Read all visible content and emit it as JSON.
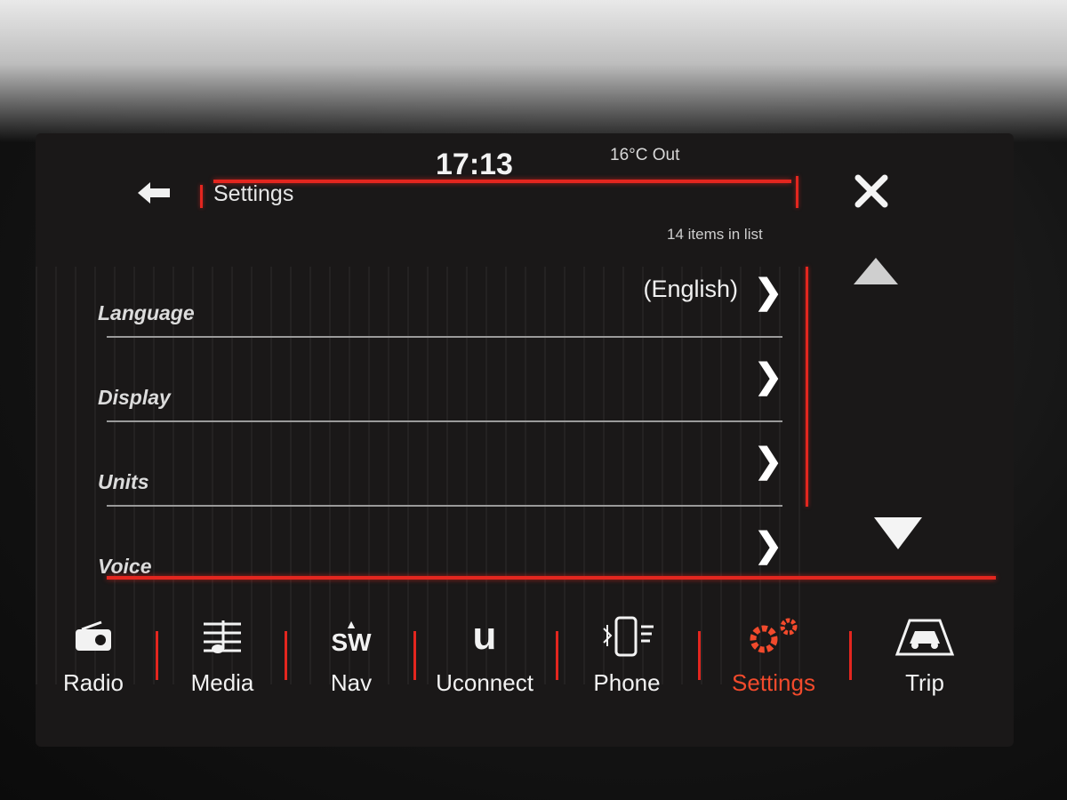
{
  "status": {
    "time": "17:13",
    "outside_temp": "16°C Out"
  },
  "header": {
    "title": "Settings",
    "item_count": "14 items in list"
  },
  "settings_list": [
    {
      "label": "Language",
      "value": "(English)"
    },
    {
      "label": "Display",
      "value": ""
    },
    {
      "label": "Units",
      "value": ""
    },
    {
      "label": "Voice",
      "value": ""
    }
  ],
  "side_controls": {
    "close": "close-icon",
    "scroll_up": "triangle-up-icon",
    "scroll_down": "triangle-down-icon"
  },
  "nav": [
    {
      "label": "Radio",
      "icon": "radio-icon"
    },
    {
      "label": "Media",
      "icon": "music-note-icon"
    },
    {
      "label": "Nav",
      "icon": "compass-icon",
      "icon_text": "SW"
    },
    {
      "label": "Uconnect",
      "icon": "uconnect-icon",
      "icon_text": "u"
    },
    {
      "label": "Phone",
      "icon": "phone-icon"
    },
    {
      "label": "Settings",
      "icon": "gear-icon",
      "active": true
    },
    {
      "label": "Trip",
      "icon": "car-icon"
    }
  ],
  "colors": {
    "accent_red": "#e3261f",
    "active_orange": "#f24a2c",
    "screen_bg": "#1a1818"
  }
}
